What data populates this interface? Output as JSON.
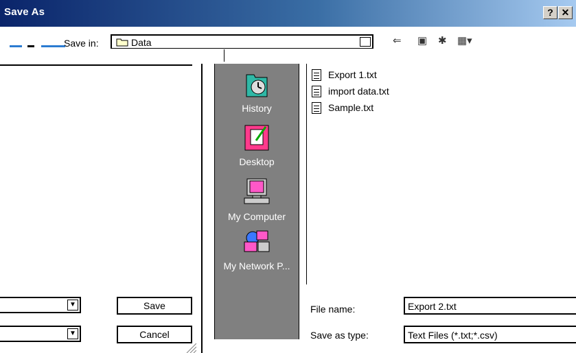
{
  "window": {
    "title": "Save As",
    "help_button": "?",
    "close_button": "✕"
  },
  "toolbar": {
    "save_in_label": "Save in:",
    "save_in_value": "Data",
    "icons": [
      "back-arrow-icon",
      "up-folder-icon",
      "new-folder-icon",
      "view-menu-icon"
    ]
  },
  "places": [
    {
      "label": "History",
      "icon": "history-icon"
    },
    {
      "label": "Desktop",
      "icon": "desktop-icon"
    },
    {
      "label": "My Computer",
      "icon": "my-computer-icon"
    },
    {
      "label": "My Network P...",
      "icon": "network-places-icon"
    }
  ],
  "files": [
    {
      "name": "Export 1.txt"
    },
    {
      "name": "import data.txt"
    },
    {
      "name": "Sample.txt"
    }
  ],
  "form": {
    "file_name_label": "File name:",
    "file_name_value": "Export 2.txt",
    "save_type_label": "Save as type:",
    "save_type_value": "Text Files (*.txt;*.csv)"
  },
  "buttons": {
    "save": "Save",
    "cancel": "Cancel"
  },
  "colors": {
    "title_start": "#0a246a",
    "title_end": "#a6caf0",
    "places_bg": "#808080"
  }
}
